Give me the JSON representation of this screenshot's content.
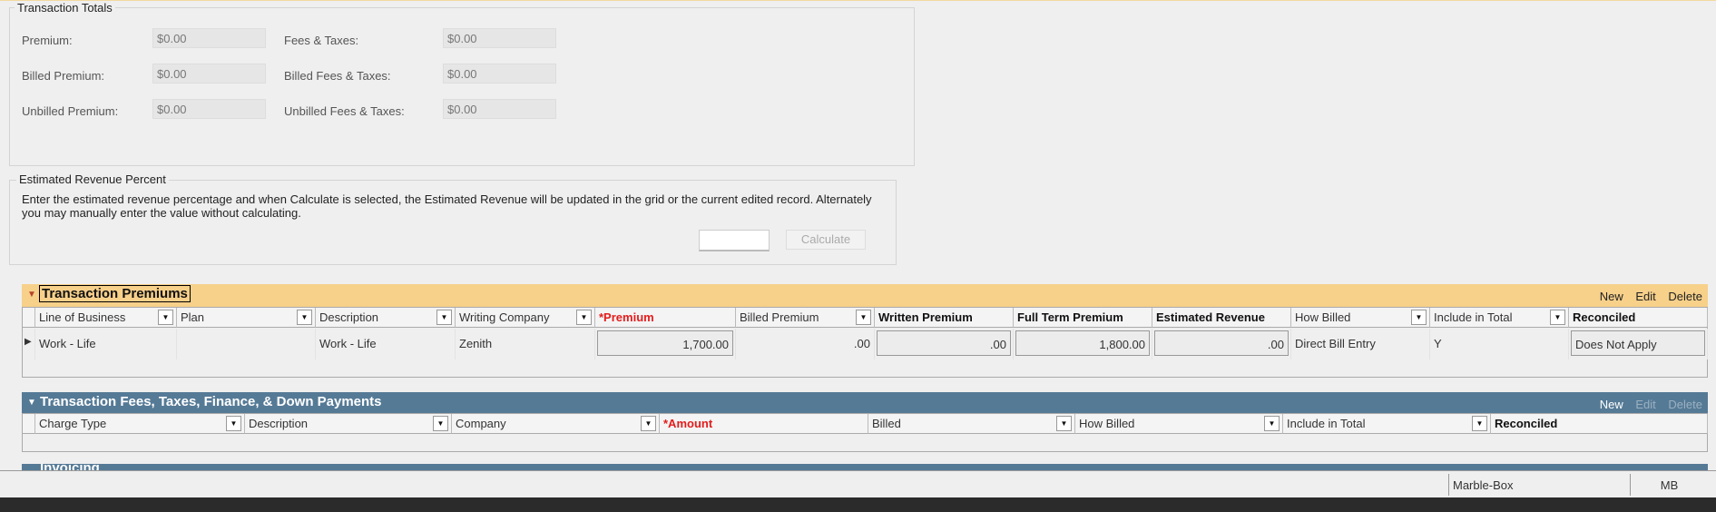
{
  "totals": {
    "legend": "Transaction Totals",
    "fields": [
      {
        "label": "Premium:",
        "value": "$0.00"
      },
      {
        "label": "Fees & Taxes:",
        "value": "$0.00"
      },
      {
        "label": "Billed Premium:",
        "value": "$0.00"
      },
      {
        "label": "Billed Fees & Taxes:",
        "value": "$0.00"
      },
      {
        "label": "Unbilled Premium:",
        "value": "$0.00"
      },
      {
        "label": "Unbilled Fees & Taxes:",
        "value": "$0.00"
      }
    ]
  },
  "revenue": {
    "legend": "Estimated Revenue Percent",
    "description": "Enter the estimated revenue percentage and when Calculate is selected, the Estimated Revenue will be updated in the grid or the current edited record. Alternately you may manually enter the value without calculating.",
    "input_value": "",
    "calculate_label": "Calculate"
  },
  "premiums": {
    "title": "Transaction Premiums",
    "color": "#f7d08a",
    "actions": [
      "New",
      "Edit",
      "Delete"
    ],
    "columns": [
      "Line of Business",
      "Plan",
      "Description",
      "Writing Company",
      "*Premium",
      "Billed Premium",
      "Written Premium",
      "Full Term Premium",
      "Estimated Revenue",
      "How Billed",
      "Include in Total",
      "Reconciled"
    ],
    "rows": [
      [
        "Work - Life",
        "",
        "Work - Life",
        "Zenith",
        "1,700.00",
        ".00",
        ".00",
        "1,800.00",
        ".00",
        "Direct Bill Entry",
        "Y",
        "Does Not Apply"
      ]
    ]
  },
  "fees": {
    "title": "Transaction Fees, Taxes, Finance, & Down Payments",
    "color": "#557a96",
    "actions": [
      "New",
      "Edit",
      "Delete"
    ],
    "columns": [
      "Charge Type",
      "Description",
      "Company",
      "*Amount",
      "Billed",
      "How Billed",
      "Include in Total",
      "Reconciled"
    ],
    "rows": []
  },
  "invoicing": {
    "title": "Invoicing"
  },
  "statusbar": {
    "company": "Marble-Box",
    "initials": "MB"
  }
}
